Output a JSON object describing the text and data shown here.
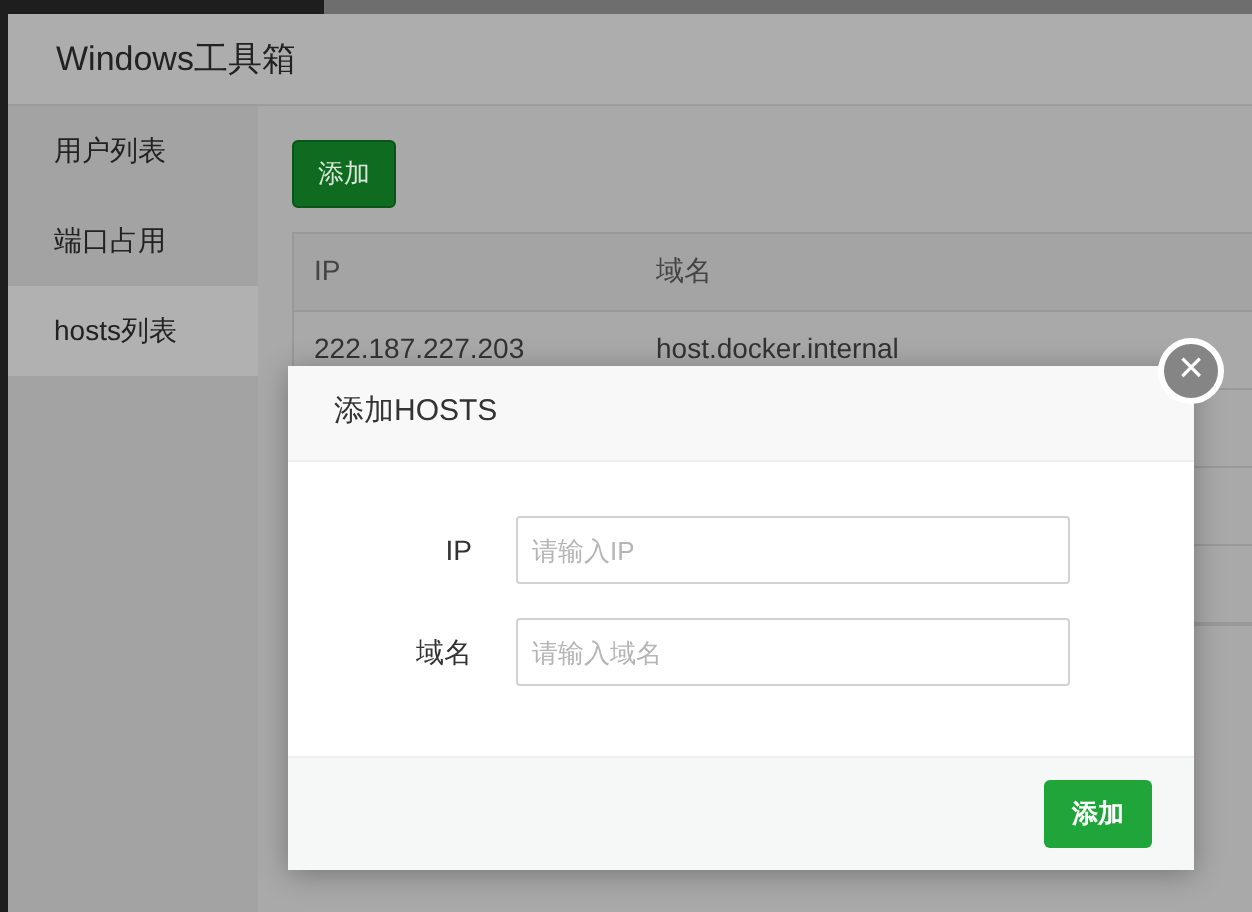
{
  "window": {
    "title": "Windows工具箱"
  },
  "sidebar": {
    "items": [
      {
        "label": "用户列表",
        "selected": false
      },
      {
        "label": "端口占用",
        "selected": false
      },
      {
        "label": "hosts列表",
        "selected": true
      }
    ]
  },
  "toolbar": {
    "add_button": "添加"
  },
  "table": {
    "columns": [
      "IP",
      "域名"
    ],
    "rows": [
      [
        "222.187.227.203",
        "host.docker.internal"
      ]
    ]
  },
  "dialog": {
    "title": "添加HOSTS",
    "close": "×",
    "fields": [
      {
        "label": "IP",
        "placeholder": "请输入IP"
      },
      {
        "label": "域名",
        "placeholder": "请输入域名"
      }
    ],
    "submit": "添加"
  }
}
